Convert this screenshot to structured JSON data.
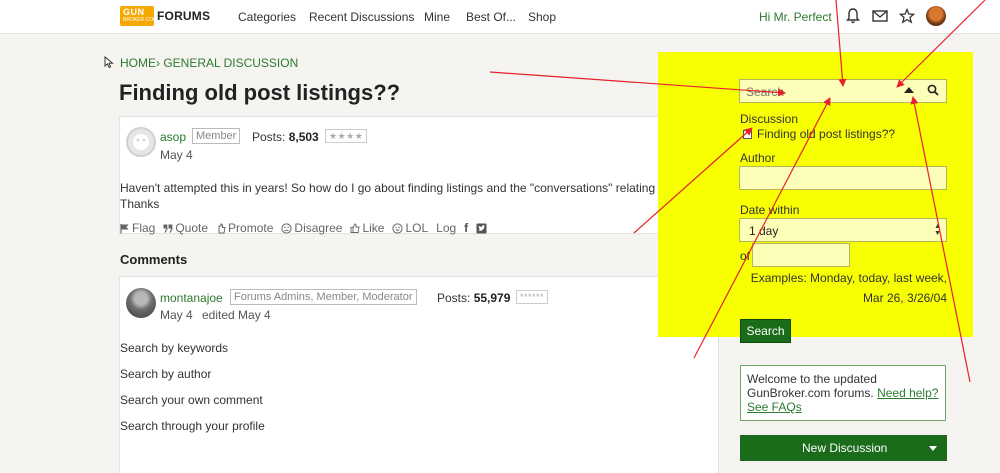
{
  "header": {
    "logo_text": "GUN",
    "logo_sub": "BROKER.COM",
    "forums_label": "FORUMS",
    "nav": [
      "Categories",
      "Recent Discussions",
      "Mine",
      "Best Of...",
      "Shop"
    ],
    "greeting": "Hi Mr. Perfect"
  },
  "breadcrumb": {
    "home": "HOME",
    "separator": "›",
    "section": "GENERAL DISCUSSION"
  },
  "discussion": {
    "title": "Finding old post listings??",
    "post": {
      "author": "asop",
      "role": "Member",
      "posts_label": "Posts:",
      "posts_count": "8,503",
      "stars": "★★★★",
      "date": "May 4",
      "body_line1": "Haven't attempted this in years! So how do I go about finding listings and the \"conversations\" relating to them?",
      "body_line2": "Thanks",
      "actions": {
        "flag": "Flag",
        "quote": "Quote",
        "promote": "Promote",
        "disagree": "Disagree",
        "like": "Like",
        "lol": "LOL",
        "log": "Log"
      }
    }
  },
  "comments": {
    "heading": "Comments",
    "comment": {
      "author": "montanajoe",
      "role": "Forums Admins, Member, Moderator",
      "posts_label": "Posts:",
      "posts_count": "55,979",
      "stars": "******",
      "date": "May 4",
      "edited": "edited May 4",
      "lines": [
        "Search by keywords",
        "Search by author",
        "Search your own comment",
        "Search through your profile"
      ]
    }
  },
  "search_panel": {
    "placeholder": "Search",
    "discussion_label": "Discussion",
    "discussion_option": "Finding old post listings??",
    "author_label": "Author",
    "date_within_label": "Date within",
    "date_within_value": "1 day",
    "of_label": "of",
    "examples_line1": "Examples: Monday, today, last week,",
    "examples_line2": "Mar 26, 3/26/04",
    "search_button": "Search"
  },
  "welcome": {
    "text": "Welcome to the updated GunBroker.com forums.",
    "need_help": "Need help?",
    "see_faqs": "See FAQs"
  },
  "new_discussion_button": "New Discussion",
  "colors": {
    "brand_green": "#2d7a2d",
    "button_green": "#1a6b1a",
    "highlight_yellow": "#f8ff00",
    "annotation_red": "#e8202a",
    "logo_orange": "#f5a800"
  }
}
